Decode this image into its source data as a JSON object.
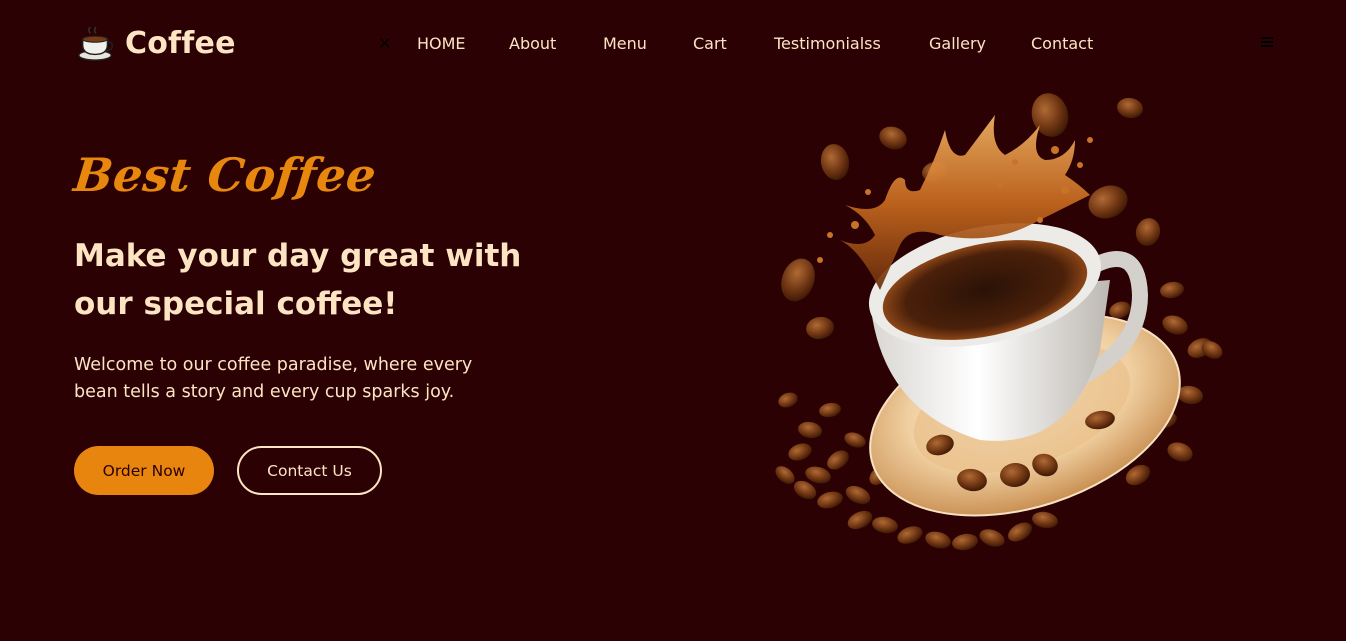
{
  "brand": {
    "name": "Coffee",
    "icon": "coffee-cup-icon"
  },
  "nav": {
    "close_icon": "×",
    "items": [
      "HOME",
      "About",
      "Menu",
      "Cart",
      "Testimonialss",
      "Gallery",
      "Contact"
    ],
    "menu_icon": "hamburger-icon"
  },
  "hero": {
    "kicker": "Best Coffee",
    "headline": "Make your day great with our special coffee!",
    "subtext": "Welcome to our coffee paradise, where every bean tells a story and every cup sparks joy.",
    "primary_button": "Order Now",
    "secondary_button": "Contact Us"
  },
  "colors": {
    "background": "#2b0103",
    "accent": "#e8850f",
    "text": "#fde4c3"
  }
}
